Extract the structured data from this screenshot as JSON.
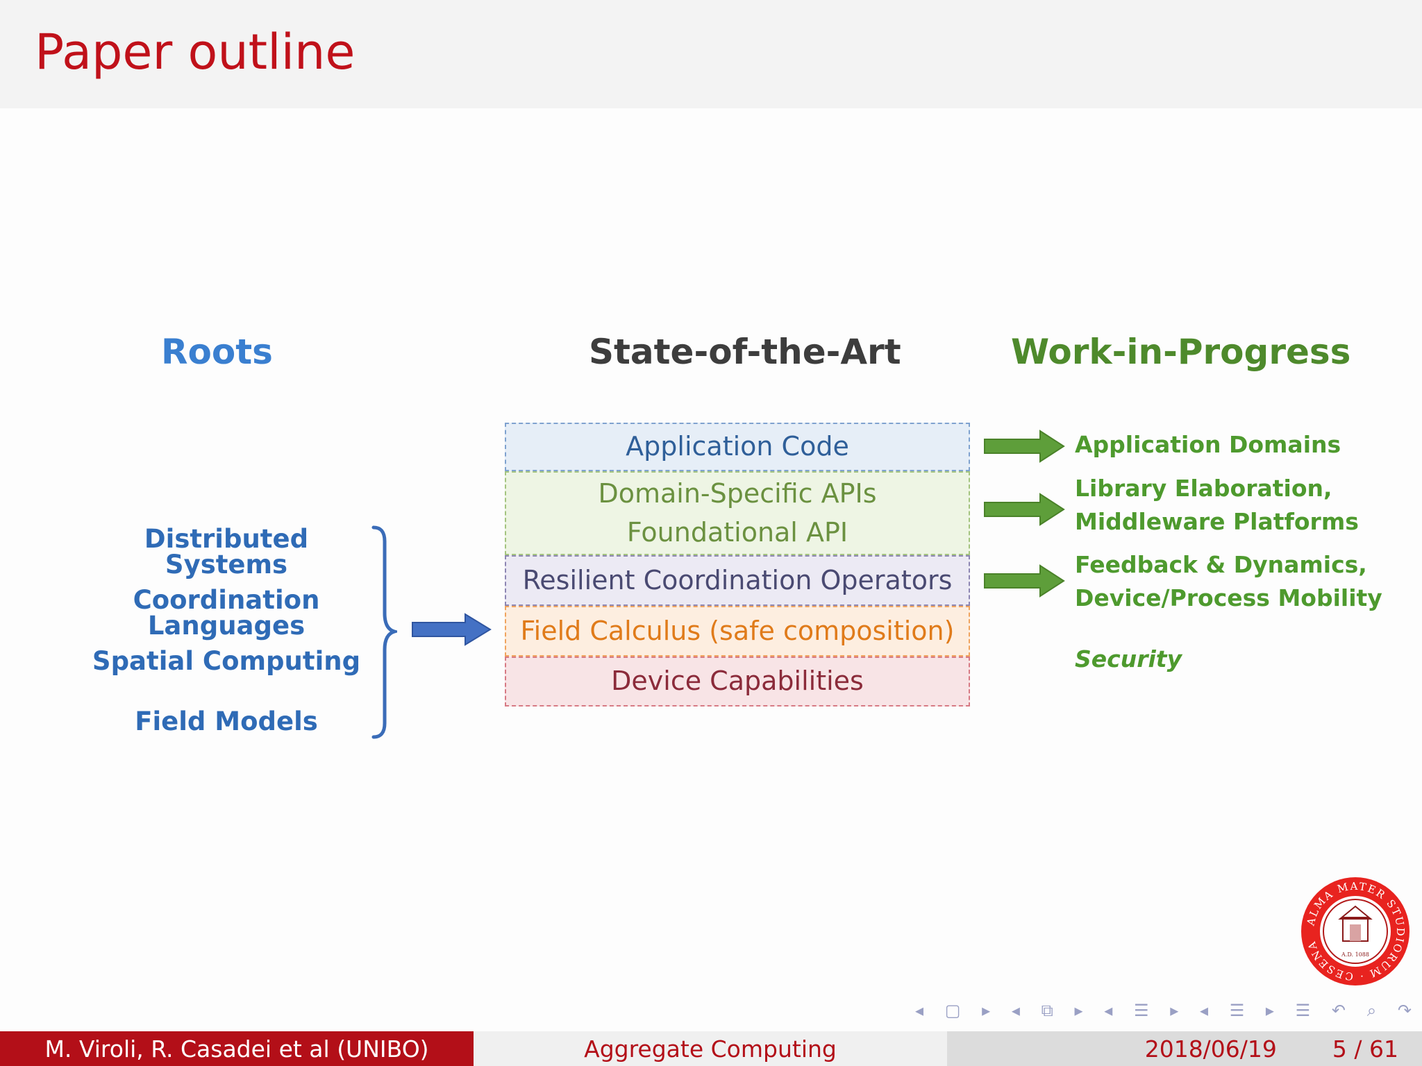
{
  "slide": {
    "title": "Paper outline"
  },
  "columns": {
    "roots": {
      "heading": "Roots",
      "color": "#3a7fd0"
    },
    "state_of_the_art": {
      "heading": "State-of-the-Art",
      "color": "#3d3d3d"
    },
    "work_in_progress": {
      "heading": "Work-in-Progress",
      "color": "#4e8a2c"
    }
  },
  "roots_items": [
    "Distributed Systems",
    "Coordination Languages",
    "Spatial Computing",
    "Field Models"
  ],
  "layers": [
    {
      "lines": [
        "Application Code"
      ],
      "text_color": "#2f5f99",
      "fill": "#e6eef7",
      "border": "#7fa2cf"
    },
    {
      "lines": [
        "Domain-Specific APIs",
        "Foundational API"
      ],
      "text_color": "#6b9140",
      "fill": "#eef5e4",
      "border": "#a4c47f"
    },
    {
      "lines": [
        "Resilient Coordination Operators"
      ],
      "text_color": "#4a4a72",
      "fill": "#eceaf4",
      "border": "#8d86b3"
    },
    {
      "lines": [
        "Field Calculus (safe composition)"
      ],
      "text_color": "#e07b1a",
      "fill": "#fdeee0",
      "border": "#f0a45e"
    },
    {
      "lines": [
        "Device Capabilities"
      ],
      "text_color": "#8b2b3a",
      "fill": "#f8e4e6",
      "border": "#d77a84"
    }
  ],
  "wip_items": [
    {
      "lines": [
        "Application Domains"
      ],
      "italic": false
    },
    {
      "lines": [
        "Library Elaboration,",
        "Middleware Platforms"
      ],
      "italic": false
    },
    {
      "lines": [
        "Feedback & Dynamics,",
        "Device/Process Mobility"
      ],
      "italic": false
    },
    {
      "lines": [
        "Security"
      ],
      "italic": true
    }
  ],
  "nav_icons": [
    "prev-frame-icon",
    "frame-icon",
    "next-frame-icon",
    "prev-subsection-icon",
    "subsection-icon",
    "next-subsection-icon",
    "prev-section-icon",
    "section-icon",
    "next-section-icon",
    "prev-presentation-icon",
    "presentation-icon",
    "next-presentation-icon",
    "outline-icon",
    "undo-icon",
    "search-icon",
    "redo-icon"
  ],
  "footer": {
    "authors": "M. Viroli, R. Casadei et al  (UNIBO)",
    "talk_title": "Aggregate Computing",
    "date": "2018/06/19",
    "page": "5 / 61"
  },
  "logo": {
    "text": "ALMA MATER STUDIORUM · CESENA",
    "inner_text": "A.D. 1088"
  },
  "colors": {
    "title_red": "#c0111a",
    "footer_red": "#b30f18",
    "roots_blue": "#2f6bb6",
    "arrow_blue": "#4471c4",
    "arrow_green": "#5e9e3a"
  }
}
